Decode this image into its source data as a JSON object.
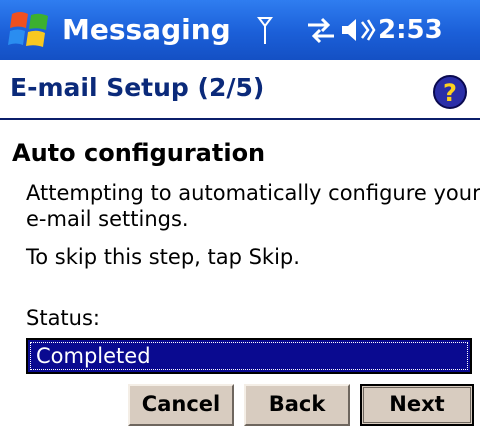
{
  "title_bar": {
    "app_title": "Messaging",
    "time": "2:53",
    "icons": [
      "windows-start-icon",
      "antenna-icon",
      "sync-icon",
      "speaker-icon"
    ],
    "background": "#1b5fd8"
  },
  "header": {
    "title": "E-mail Setup (2/5)",
    "help_icon": "help-icon",
    "title_color": "#0b2a7a"
  },
  "content": {
    "heading": "Auto configuration",
    "message_line1": "Attempting to automatically configure your",
    "message_line2": "e-mail settings.",
    "skip_hint": "To skip this step, tap Skip.",
    "status_label": "Status:",
    "status_value": "Completed",
    "status_field_color": "#0a0a90"
  },
  "buttons": {
    "cancel": "Cancel",
    "back": "Back",
    "next": "Next",
    "face_color": "#d8ccc0"
  }
}
